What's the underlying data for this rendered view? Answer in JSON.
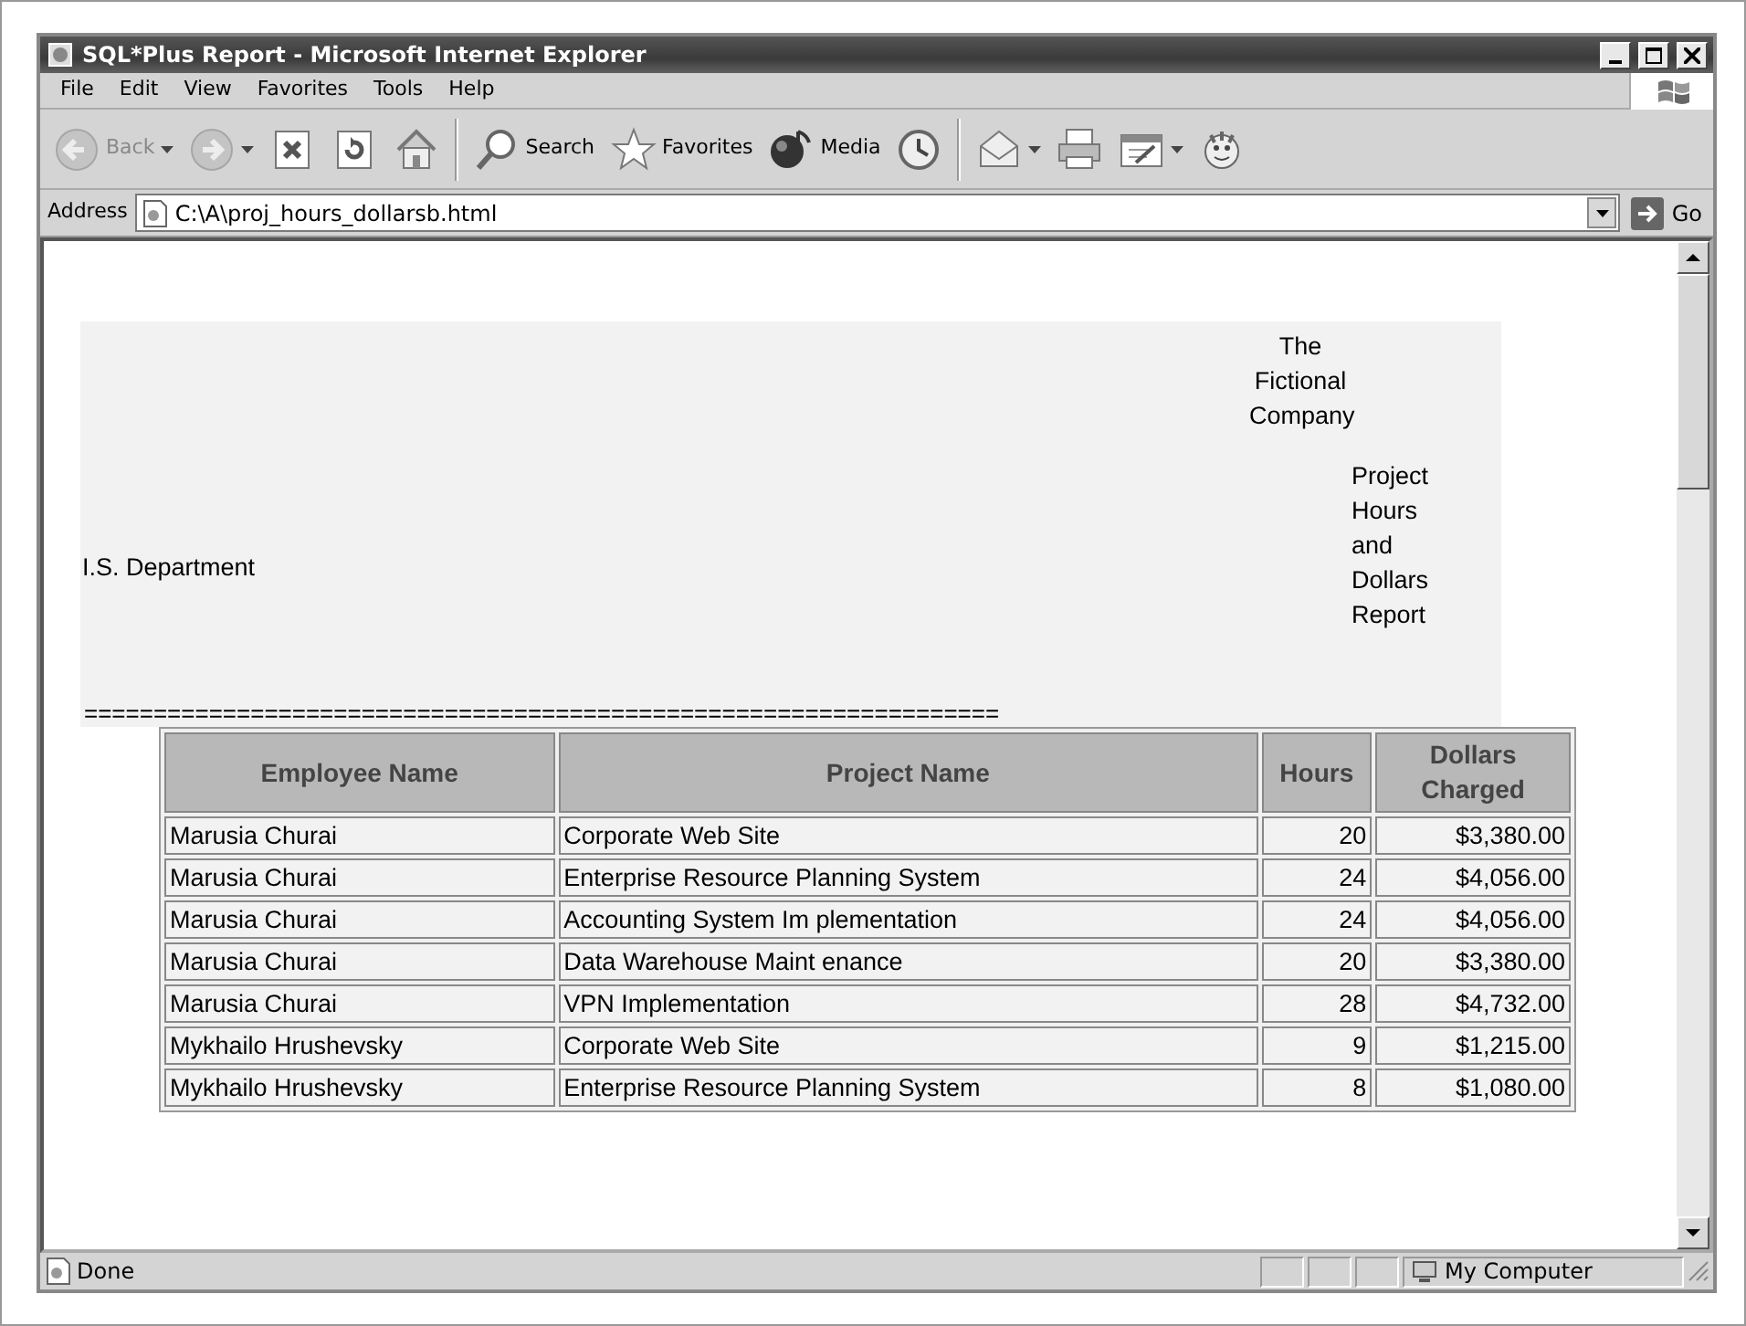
{
  "window": {
    "title": "SQL*Plus Report - Microsoft Internet Explorer"
  },
  "menu": [
    "File",
    "Edit",
    "View",
    "Favorites",
    "Tools",
    "Help"
  ],
  "toolbar": [
    {
      "kind": "back",
      "label": "Back",
      "dropdown": true,
      "disabled": true
    },
    {
      "kind": "forward",
      "dropdown": true,
      "disabled": true
    },
    {
      "kind": "stop",
      "dropdown": false,
      "disabled": false
    },
    {
      "kind": "refresh",
      "dropdown": false,
      "disabled": false
    },
    {
      "kind": "home",
      "dropdown": false,
      "disabled": false
    },
    {
      "kind": "separator"
    },
    {
      "kind": "search",
      "label": "Search",
      "dropdown": false,
      "disabled": false
    },
    {
      "kind": "favorites",
      "label": "Favorites",
      "dropdown": false,
      "disabled": false
    },
    {
      "kind": "media",
      "label": "Media",
      "dropdown": false,
      "disabled": false
    },
    {
      "kind": "history",
      "dropdown": false,
      "disabled": false
    },
    {
      "kind": "separator"
    },
    {
      "kind": "mail",
      "dropdown": true,
      "disabled": false
    },
    {
      "kind": "print",
      "dropdown": false,
      "disabled": false
    },
    {
      "kind": "edit",
      "dropdown": true,
      "disabled": false
    },
    {
      "kind": "messenger",
      "dropdown": false,
      "disabled": false
    }
  ],
  "address_bar": {
    "label": "Address",
    "value": "C:\\A\\proj_hours_dollarsb.html",
    "go": "Go"
  },
  "report": {
    "company": "The Fictional Company",
    "department": "I.S. Department",
    "title": "Project Hours and Dollars Report",
    "rule": "=================================================================="
  },
  "table": {
    "columns": [
      "Employee Name",
      "Project Name",
      "Hours",
      "Dollars Charged"
    ],
    "rows": [
      [
        "Marusia Churai",
        "Corporate Web Site",
        "20",
        "$3,380.00"
      ],
      [
        "Marusia Churai",
        "Enterprise Resource Planning System",
        "24",
        "$4,056.00"
      ],
      [
        "Marusia Churai",
        "Accounting System Im plementation",
        "24",
        "$4,056.00"
      ],
      [
        "Marusia Churai",
        "Data Warehouse Maint enance",
        "20",
        "$3,380.00"
      ],
      [
        "Marusia Churai",
        "VPN Implementation",
        "28",
        "$4,732.00"
      ],
      [
        "Mykhailo Hrushevsky",
        "Corporate Web Site",
        "9",
        "$1,215.00"
      ],
      [
        "Mykhailo Hrushevsky",
        "Enterprise Resource Planning System",
        "8",
        "$1,080.00"
      ]
    ]
  },
  "status_bar": {
    "text": "Done",
    "zone": "My Computer"
  }
}
